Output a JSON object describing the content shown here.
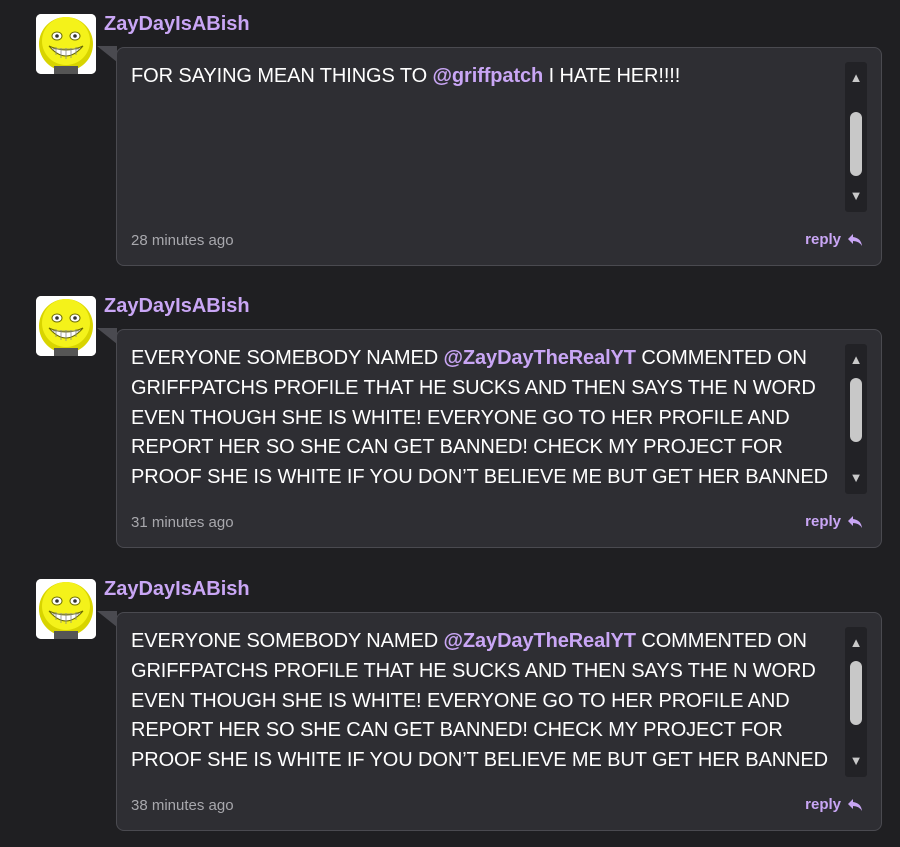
{
  "colors": {
    "background": "#1f1f22",
    "bubble": "#2e2e33",
    "accent": "#c9a6f5",
    "text": "#ffffff",
    "muted": "#a8a8ad"
  },
  "comments": [
    {
      "username": "ZayDayIsABish",
      "text_before": "GRIFFPATCHS PROFILE THAT HE SUCKS AND THEN SAYS THE N WORD EVEN THOUGH SHE IS WHITE! EVERYONE GO TO HER PROFILE AND REPORT HER SO SHE CAN GET BANNED! CHECK MY PROJECT FOR PROOF SHE IS WHITE IF YOU DON’T BELIEVE ME BUT GET HER BANNED FOR SAYING MEAN THINGS TO ",
      "mention": "@griffpatch",
      "text_after": " I HATE HER!!!!",
      "timestamp": "28 minutes ago",
      "reply_label": "reply",
      "scroll_position": 0.95
    },
    {
      "username": "ZayDayIsABish",
      "text_before": "EVERYONE SOMEBODY NAMED ",
      "mention": "@ZayDayTheRealYT",
      "text_after": " COMMENTED ON GRIFFPATCHS PROFILE THAT HE SUCKS AND THEN SAYS THE N WORD EVEN THOUGH SHE IS WHITE! EVERYONE GO TO HER PROFILE AND REPORT HER SO SHE CAN GET BANNED! CHECK MY PROJECT FOR PROOF SHE IS WHITE IF YOU DON’T BELIEVE ME BUT GET HER BANNED FOR SAYING MEAN THINGS TO @griffpatch I HATE HER!!!!",
      "timestamp": "31 minutes ago",
      "reply_label": "reply",
      "scroll_position": 0.0
    },
    {
      "username": "ZayDayIsABish",
      "text_before": "EVERYONE SOMEBODY NAMED ",
      "mention": "@ZayDayTheRealYT",
      "text_after": " COMMENTED ON GRIFFPATCHS PROFILE THAT HE SUCKS AND THEN SAYS THE N WORD EVEN THOUGH SHE IS WHITE! EVERYONE GO TO HER PROFILE AND REPORT HER SO SHE CAN GET BANNED! CHECK MY PROJECT FOR PROOF SHE IS WHITE IF YOU DON’T BELIEVE ME BUT GET HER BANNED FOR SAYING MEAN THINGS TO @griffpatch I HATE HER!!!!",
      "timestamp": "38 minutes ago",
      "reply_label": "reply",
      "scroll_position": 0.0
    }
  ],
  "icons": {
    "avatar": "yellow-grinning-face",
    "scroll_up": "triangle-up-icon",
    "scroll_down": "triangle-down-icon",
    "reply": "reply-arrow-icon"
  }
}
